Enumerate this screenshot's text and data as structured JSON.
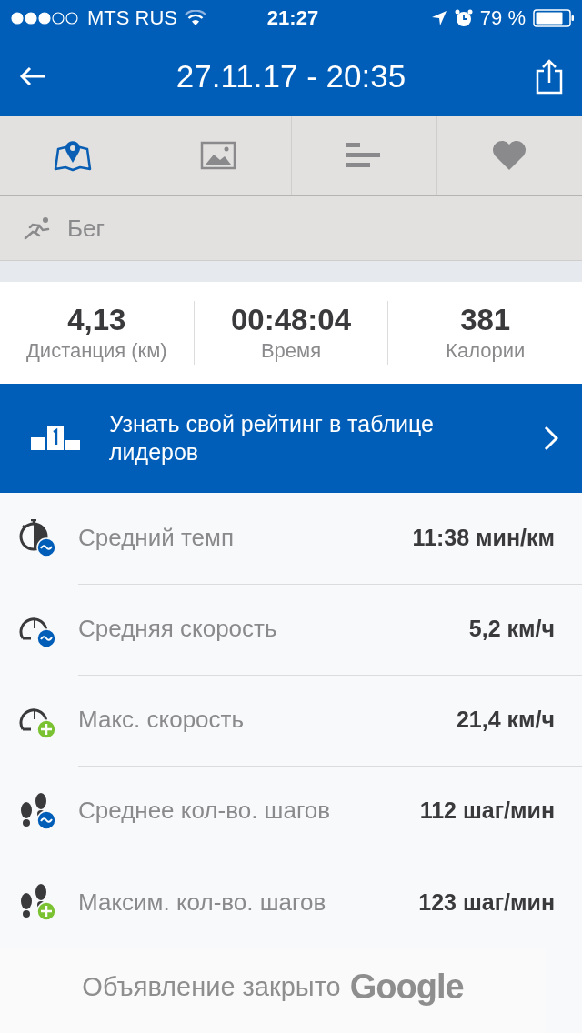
{
  "status_bar": {
    "carrier": "MTS RUS",
    "time": "21:27",
    "battery": "79 %"
  },
  "header": {
    "title": "27.11.17 - 20:35"
  },
  "tabs": [
    {
      "kind": "map",
      "selected": true
    },
    {
      "kind": "photo",
      "selected": false
    },
    {
      "kind": "bars",
      "selected": false
    },
    {
      "kind": "heart",
      "selected": false
    }
  ],
  "activity": {
    "label": "Бег"
  },
  "summary": [
    {
      "value": "4,13",
      "label": "Дистанция (км)"
    },
    {
      "value": "00:48:04",
      "label": "Время"
    },
    {
      "value": "381",
      "label": "Калории"
    }
  ],
  "leaderboard_banner": {
    "text": "Узнать свой рейтинг в таблице лидеров"
  },
  "stats": [
    {
      "kind": "pace",
      "max": false,
      "label": "Средний темп",
      "value": "11:38 мин/км"
    },
    {
      "kind": "speed",
      "max": false,
      "label": "Средняя скорость",
      "value": "5,2 км/ч"
    },
    {
      "kind": "speed",
      "max": true,
      "label": "Макс. скорость",
      "value": "21,4 км/ч"
    },
    {
      "kind": "steps",
      "max": false,
      "label": "Среднее кол-во. шагов",
      "value": "112 шаг/мин"
    },
    {
      "kind": "steps",
      "max": true,
      "label": "Максим. кол-во. шагов",
      "value": "123 шаг/мин"
    }
  ],
  "ad": {
    "text": "Объявление закрыто",
    "brand": "Google"
  }
}
